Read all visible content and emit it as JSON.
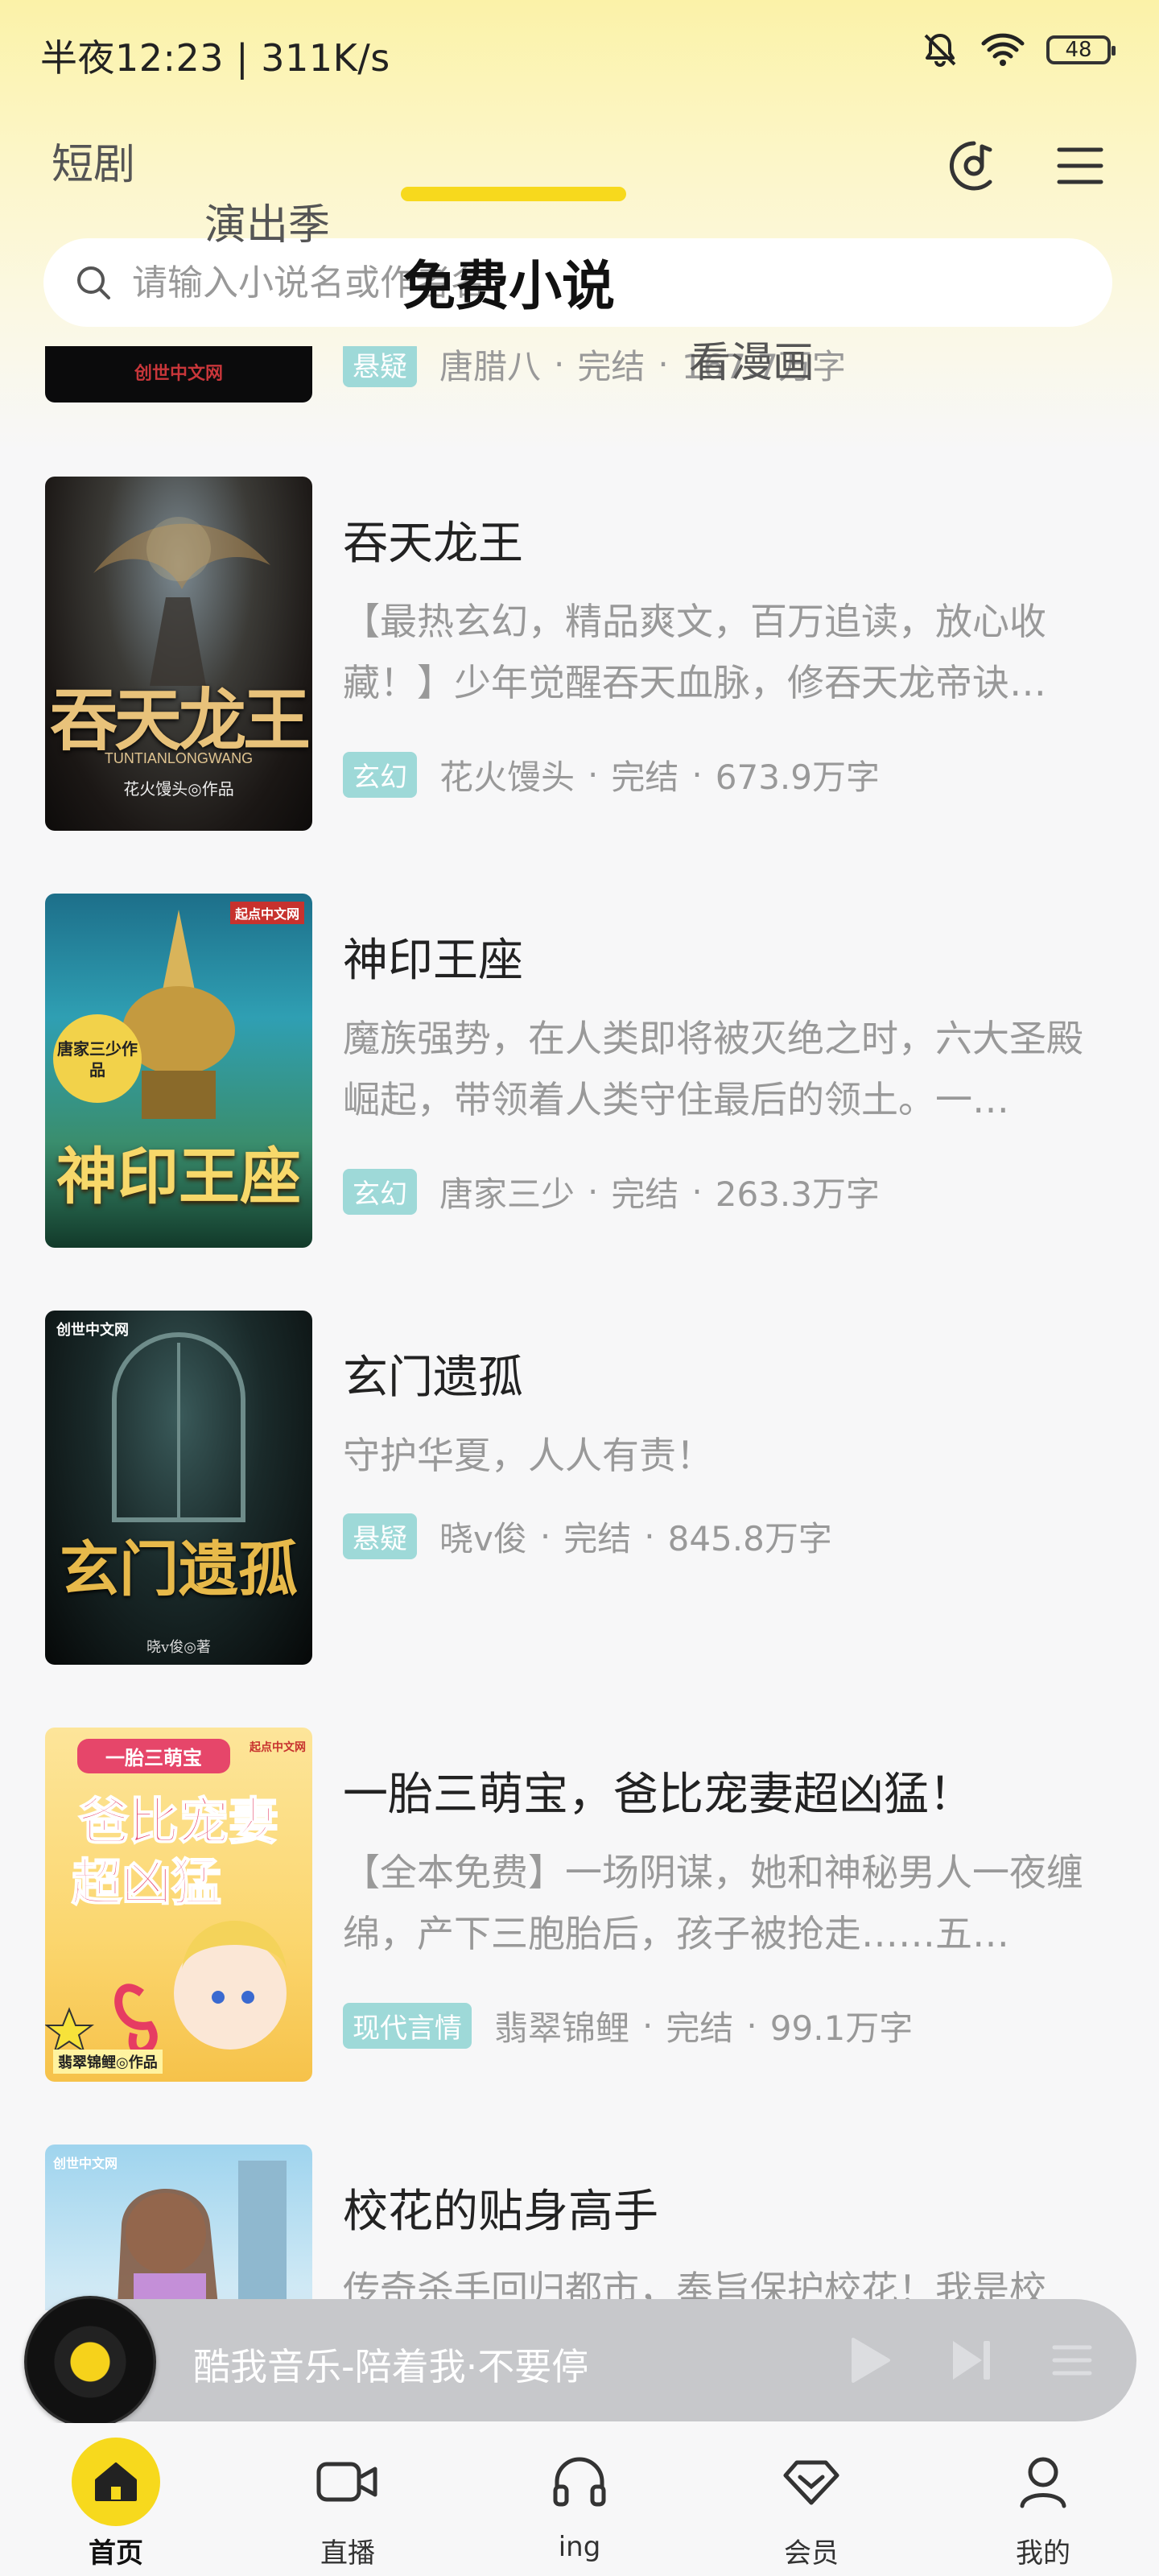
{
  "status_bar": {
    "time": "半夜12:23 | 311K/s",
    "battery": "48"
  },
  "tabs": [
    {
      "label": "短剧"
    },
    {
      "label": "演出季"
    },
    {
      "label": "免费小说"
    },
    {
      "label": "看漫画"
    }
  ],
  "active_tab": "免费小说",
  "search": {
    "placeholder": "请输入小说名或作者名",
    "value": ""
  },
  "books": [
    {
      "title": "",
      "tag": "悬疑",
      "author": "唐腊八",
      "status": "完结",
      "words": "167.7万字",
      "cover_text": "创世中文网"
    },
    {
      "title": "吞天龙王",
      "desc": "【最热玄幻，精品爽文，百万追读，放心收藏！】少年觉醒吞天血脉，修吞天龙帝诀…",
      "tag": "玄幻",
      "author": "花火馒头",
      "status": "完结",
      "words": "673.9万字",
      "cover_text": "吞天龙王",
      "cover_sub": "TUNTIANLONGWANG",
      "cover_author": "花火馒头◎作品"
    },
    {
      "title": "神印王座",
      "desc": "魔族强势，在人类即将被灭绝之时，六大圣殿崛起，带领着人类守住最后的领土。一…",
      "tag": "玄幻",
      "author": "唐家三少",
      "status": "完结",
      "words": "263.3万字",
      "cover_text": "神印王座",
      "cover_badge": "唐家三少作品",
      "cover_brand": "起点中文网"
    },
    {
      "title": "玄门遗孤",
      "desc": "守护华夏，人人有责！",
      "tag": "悬疑",
      "author": "晓v俊",
      "status": "完结",
      "words": "845.8万字",
      "cover_text": "玄门遗孤",
      "cover_brand": "创世中文网",
      "cover_author": "晓v俊◎著"
    },
    {
      "title": "一胎三萌宝，爸比宠妻超凶猛！",
      "desc": "【全本免费】一场阴谋，她和神秘男人一夜缠绵，产下三胞胎后，孩子被抢走……五…",
      "tag": "现代言情",
      "author": "翡翠锦鲤",
      "status": "完结",
      "words": "99.1万字",
      "cover_top": "一胎三萌宝",
      "cover_line1": "爸比宠妻",
      "cover_line2": "超凶猛",
      "cover_author": "翡翠锦鲤◎作品",
      "cover_brand": "起点中文网"
    },
    {
      "title": "校花的贴身高手",
      "desc": "传奇杀手回归都市，奉旨保护校花！我是校",
      "cover_brand": "创世中文网"
    }
  ],
  "music": {
    "title": "酷我音乐-陪着我·不要停"
  },
  "nav": [
    {
      "label": "首页",
      "icon": "home-icon"
    },
    {
      "label": "直播",
      "icon": "video-camera-icon"
    },
    {
      "label": "ing",
      "icon": "headphones-icon"
    },
    {
      "label": "会员",
      "icon": "diamond-heart-icon"
    },
    {
      "label": "我的",
      "icon": "user-icon"
    }
  ],
  "colors": {
    "accent": "#f7d91d",
    "tag_bg": "#9ed9d8",
    "header_gradient": "#fbf2a8"
  }
}
